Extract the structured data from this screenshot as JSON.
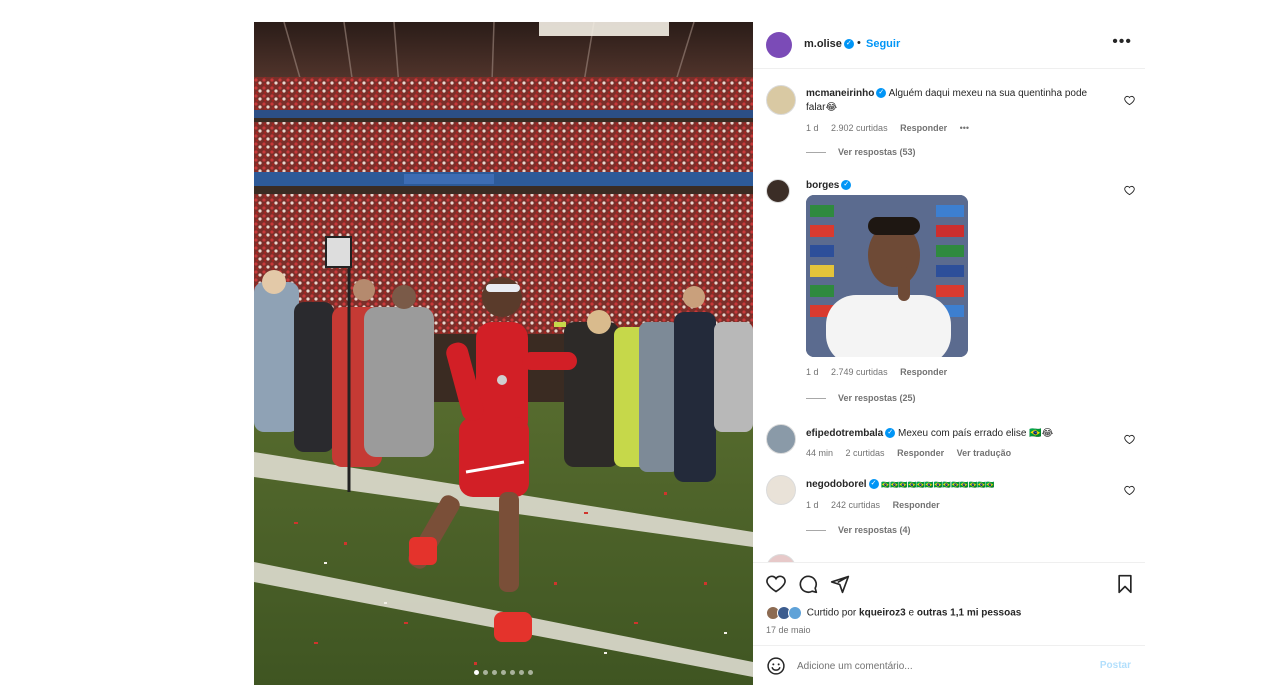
{
  "post": {
    "username": "m.olise",
    "verified_mark": "✓",
    "dot": "•",
    "follow_label": "Seguir",
    "more_label": "•••",
    "carousel_count": 7
  },
  "comments": [
    {
      "username": "mcmaneirinho",
      "text": "Alguém daqui mexeu na sua quentinha pode falar😂",
      "time": "1 d",
      "likes": "2.902 curtidas",
      "reply": "Responder",
      "more": "•••",
      "view_replies": "Ver respostas (53)"
    },
    {
      "username": "borges",
      "text": "",
      "time": "1 d",
      "likes": "2.749 curtidas",
      "reply": "Responder",
      "view_replies": "Ver respostas (25)"
    },
    {
      "username": "efipedotrembala",
      "text": "Mexeu com país errado elise 🇧🇷😂",
      "time": "44 min",
      "likes": "2 curtidas",
      "reply": "Responder",
      "translate": "Ver tradução"
    },
    {
      "username": "negodoborel",
      "text": "🇧🇷🇧🇷🇧🇷🇧🇷🇧🇷🇧🇷🇧🇷🇧🇷🇧🇷🇧🇷🇧🇷🇧🇷🇧🇷",
      "time": "1 d",
      "likes": "242 curtidas",
      "reply": "Responder",
      "view_replies": "Ver respostas (4)"
    }
  ],
  "footer": {
    "liked_by_prefix": "Curtido por",
    "liked_by_user": "kqueiroz3",
    "liked_by_and": "e",
    "liked_by_others": "outras 1,1 mi pessoas",
    "date": "17 de maio",
    "add_comment_placeholder": "Adicione um comentário...",
    "post_label": "Postar"
  },
  "colors": {
    "accent": "#0095f6",
    "jersey": "#d21f26",
    "grass": "#4f6a2a"
  }
}
